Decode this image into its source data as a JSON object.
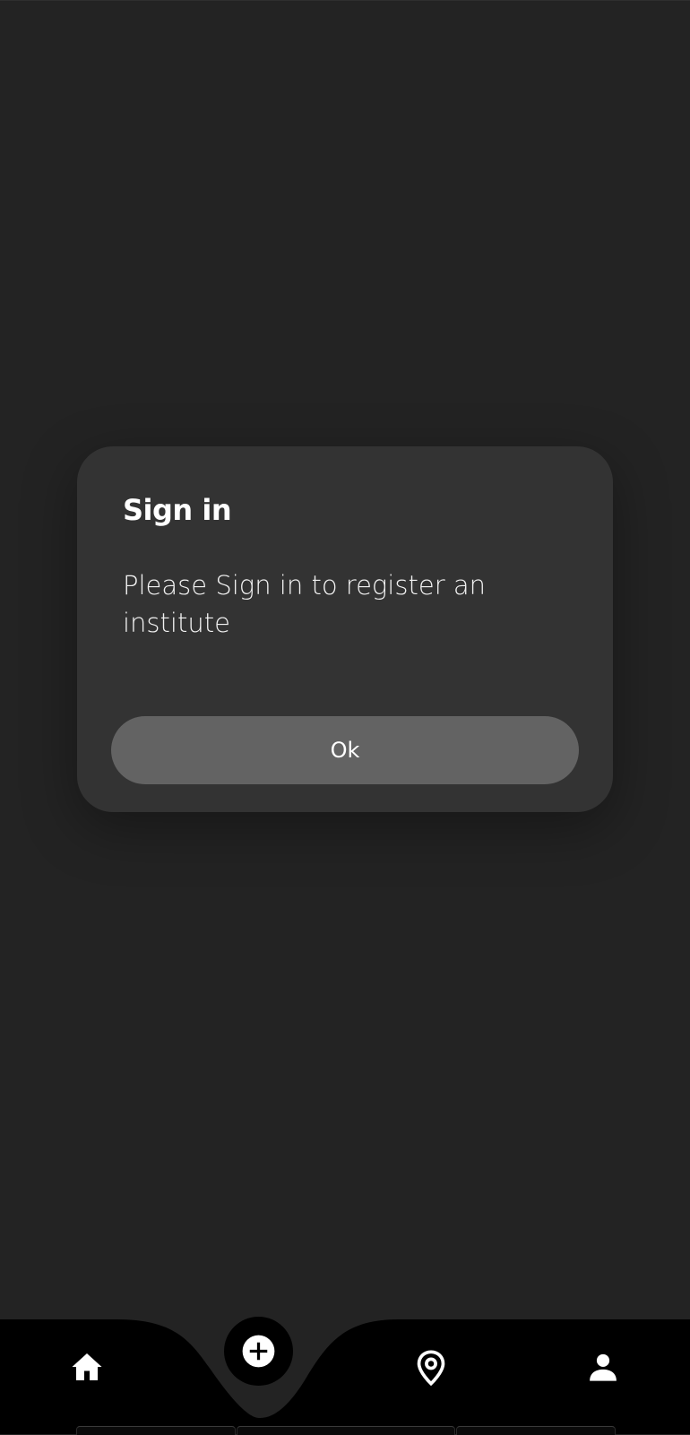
{
  "dialog": {
    "title": "Sign in",
    "message": "Please Sign in to register an institute",
    "ok_label": "Ok"
  },
  "bottom_nav": {
    "items": [
      {
        "icon": "home-icon"
      },
      {
        "icon": "add-circle-icon"
      },
      {
        "icon": "location-pin-icon"
      },
      {
        "icon": "person-icon"
      }
    ]
  },
  "colors": {
    "background": "#232323",
    "dialog": "#333333",
    "button": "#636363",
    "nav": "#000000",
    "text": "#ffffff"
  }
}
